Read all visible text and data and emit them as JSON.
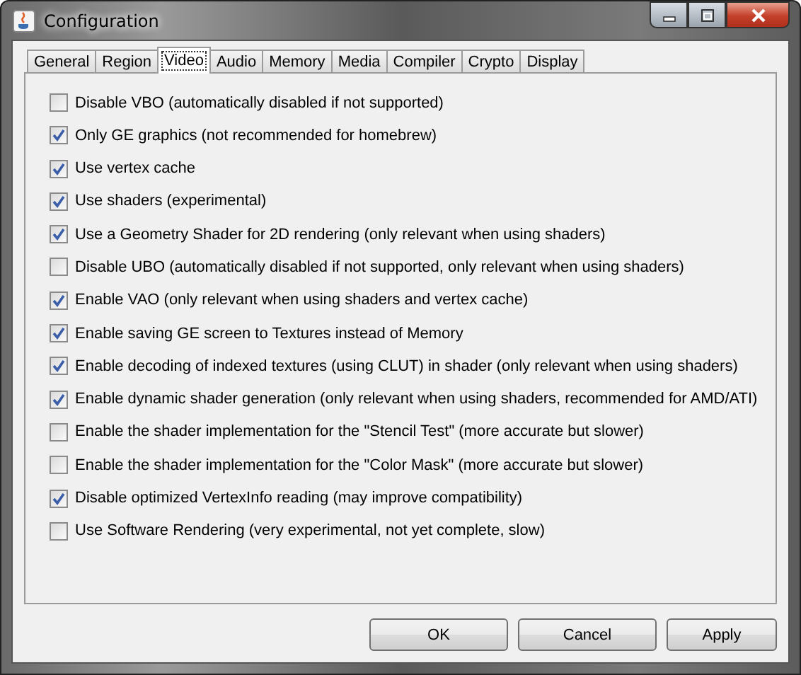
{
  "window": {
    "title": "Configuration"
  },
  "tabs": [
    {
      "label": "General",
      "selected": false
    },
    {
      "label": "Region",
      "selected": false
    },
    {
      "label": "Video",
      "selected": true
    },
    {
      "label": "Audio",
      "selected": false
    },
    {
      "label": "Memory",
      "selected": false
    },
    {
      "label": "Media",
      "selected": false
    },
    {
      "label": "Compiler",
      "selected": false
    },
    {
      "label": "Crypto",
      "selected": false
    },
    {
      "label": "Display",
      "selected": false
    }
  ],
  "options": [
    {
      "label": "Disable VBO (automatically disabled if not supported)",
      "checked": false
    },
    {
      "label": "Only GE graphics (not recommended for homebrew)",
      "checked": true
    },
    {
      "label": "Use vertex cache",
      "checked": true
    },
    {
      "label": "Use shaders (experimental)",
      "checked": true
    },
    {
      "label": "Use a Geometry Shader for 2D rendering (only relevant when using shaders)",
      "checked": true
    },
    {
      "label": "Disable UBO (automatically disabled if not supported, only relevant when using shaders)",
      "checked": false
    },
    {
      "label": "Enable VAO (only relevant when using shaders and vertex cache)",
      "checked": true
    },
    {
      "label": "Enable saving GE screen to Textures instead of Memory",
      "checked": true
    },
    {
      "label": "Enable decoding of indexed textures (using CLUT) in shader (only relevant when using shaders)",
      "checked": true
    },
    {
      "label": "Enable dynamic shader generation (only relevant when using shaders, recommended for AMD/ATI)",
      "checked": true
    },
    {
      "label": "Enable the shader implementation for the \"Stencil Test\" (more accurate but slower)",
      "checked": false
    },
    {
      "label": "Enable the shader implementation for the \"Color Mask\" (more accurate but slower)",
      "checked": false
    },
    {
      "label": "Disable optimized VertexInfo reading (may improve compatibility)",
      "checked": true
    },
    {
      "label": "Use Software Rendering (very experimental, not yet complete, slow)",
      "checked": false
    }
  ],
  "buttons": [
    "OK",
    "Cancel",
    "Apply"
  ]
}
